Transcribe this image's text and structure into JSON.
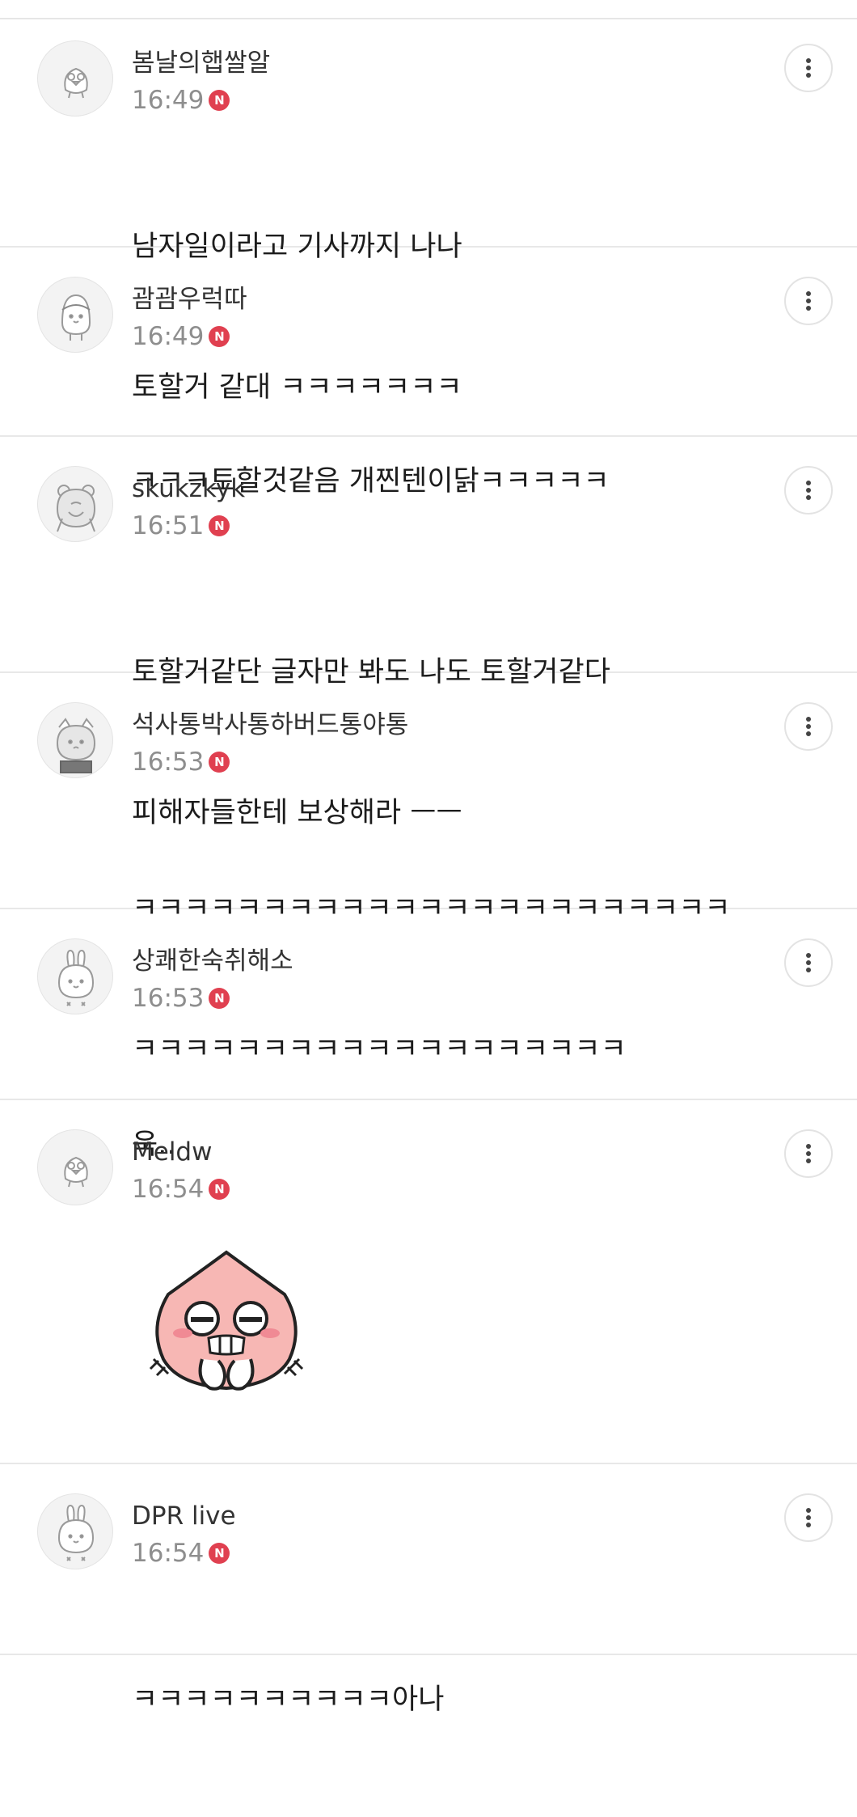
{
  "new_badge_label": "N",
  "comments": [
    {
      "nickname": "봄날의햅쌀알",
      "time": "16:49",
      "avatar_icon": "bird-character-icon",
      "lines": [
        "남자일이라고 기사까지 나나",
        "토할거 같대 ㅋㅋㅋㅋㅋㅋㅋ"
      ]
    },
    {
      "nickname": "괌괌우럭따",
      "time": "16:49",
      "avatar_icon": "penguin-character-icon",
      "lines": [
        "ㅋㅋㅋ토할것같음 개찐텐이닭ㅋㅋㅋㅋㅋ"
      ]
    },
    {
      "nickname": "skukzkyk",
      "time": "16:51",
      "avatar_icon": "bear-character-icon",
      "lines": [
        "토할거같단 글자만 봐도 나도 토할거같다",
        "피해자들한테 보상해라 ㅡㅡ"
      ]
    },
    {
      "nickname": "석사통박사통하버드통야통",
      "time": "16:53",
      "avatar_icon": "cat-character-icon",
      "lines": [
        "ㅋㅋㅋㅋㅋㅋㅋㅋㅋㅋㅋㅋㅋㅋㅋㅋㅋㅋㅋㅋㅋㅋㅋ",
        "ㅋㅋㅋㅋㅋㅋㅋㅋㅋㅋㅋㅋㅋㅋㅋㅋㅋㅋㅋ"
      ]
    },
    {
      "nickname": "상쾌한숙취해소",
      "time": "16:53",
      "avatar_icon": "rabbit-character-icon",
      "lines": [
        "욱.."
      ]
    },
    {
      "nickname": "Meldw",
      "time": "16:54",
      "avatar_icon": "bird-character-icon",
      "sticker": "peach-character-sticker",
      "lines": []
    },
    {
      "nickname": "DPR live",
      "time": "16:54",
      "avatar_icon": "rabbit-character-icon",
      "lines": [
        "ㅋㅋㅋㅋㅋㅋㅋㅋㅋㅋ아나"
      ]
    }
  ],
  "colors": {
    "badge_red": "#e04050",
    "sticker_pink": "#f7b7b4",
    "divider": "#e8e8e8",
    "time_gray": "#8e8e8e"
  }
}
